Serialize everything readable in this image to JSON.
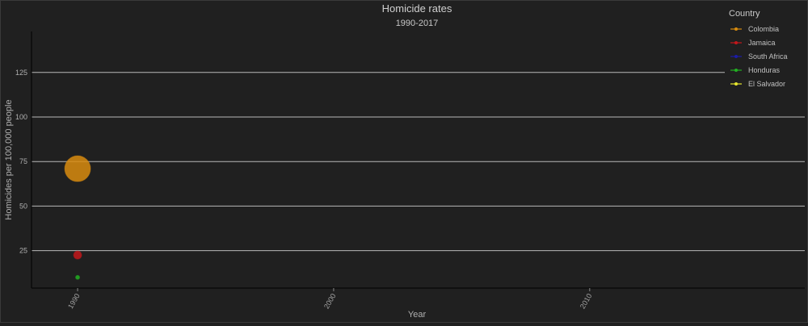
{
  "chart_data": {
    "type": "scatter",
    "title": "Homicide rates",
    "subtitle": "1990-2017",
    "xlabel": "Year",
    "ylabel": "Homicides per 100,000 people",
    "xlim": [
      1988.2,
      2018.4
    ],
    "ylim": [
      4,
      148
    ],
    "x_ticks": [
      1990,
      2000,
      2010
    ],
    "y_ticks": [
      25,
      50,
      75,
      100,
      125
    ],
    "grid": "horizontal",
    "legend": {
      "title": "Country",
      "placement": "top-right"
    },
    "series": [
      {
        "name": "Colombia",
        "color": "#d98c0f",
        "points": [
          {
            "x": 1990,
            "y": 71,
            "size": "large"
          }
        ]
      },
      {
        "name": "Jamaica",
        "color": "#c4171b",
        "points": [
          {
            "x": 1990,
            "y": 22.5,
            "size": "medium"
          }
        ]
      },
      {
        "name": "South Africa",
        "color": "#1c1ca8",
        "points": []
      },
      {
        "name": "Honduras",
        "color": "#22b022",
        "points": [
          {
            "x": 1990,
            "y": 10,
            "size": "small"
          }
        ]
      },
      {
        "name": "El Salvador",
        "color": "#e6e62e",
        "points": []
      }
    ]
  }
}
